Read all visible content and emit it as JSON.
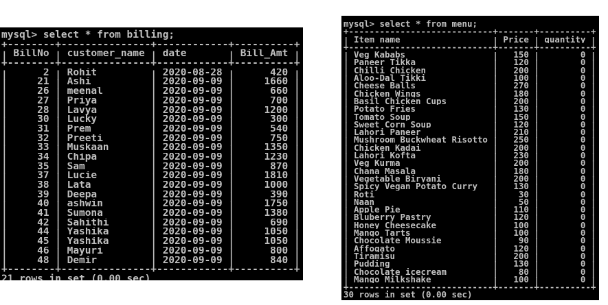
{
  "colors": {
    "page_background": "#ffffff",
    "console_background": "#000000",
    "console_text": "#c0c0c0"
  },
  "billing_console": {
    "prompt": "mysql>",
    "command": "select * from billing;",
    "columns": [
      "BillNo",
      "customer_name",
      "date",
      "Bill_Amt"
    ],
    "rows": [
      [
        2,
        "Rohit",
        "2020-08-28",
        420
      ],
      [
        21,
        "Ashi",
        "2020-09-09",
        1660
      ],
      [
        26,
        "meenal",
        "2020-09-09",
        660
      ],
      [
        27,
        "Priya",
        "2020-09-09",
        700
      ],
      [
        28,
        "Lavya",
        "2020-09-09",
        1200
      ],
      [
        30,
        "Lucky",
        "2020-09-09",
        300
      ],
      [
        31,
        "Prem",
        "2020-09-09",
        540
      ],
      [
        32,
        "Preeti",
        "2020-09-09",
        750
      ],
      [
        33,
        "Muskaan",
        "2020-09-09",
        1350
      ],
      [
        34,
        "Chipa",
        "2020-09-09",
        1230
      ],
      [
        35,
        "Sam",
        "2020-09-09",
        870
      ],
      [
        37,
        "Lucie",
        "2020-09-09",
        1810
      ],
      [
        38,
        "Lata",
        "2020-09-09",
        1000
      ],
      [
        39,
        "Deepa",
        "2020-09-09",
        390
      ],
      [
        40,
        "ashwin",
        "2020-09-09",
        1750
      ],
      [
        41,
        "Sumona",
        "2020-09-09",
        1380
      ],
      [
        42,
        "Sahithi",
        "2020-09-09",
        690
      ],
      [
        44,
        "Yashika",
        "2020-09-09",
        1050
      ],
      [
        45,
        "Yashika",
        "2020-09-09",
        1050
      ],
      [
        46,
        "Mayuri",
        "2020-09-09",
        800
      ],
      [
        48,
        "Demir",
        "2020-09-09",
        840
      ]
    ],
    "summary": "21 rows in set (0.00 sec)"
  },
  "menu_console": {
    "prompt": "mysql>",
    "command": "select * from menu;",
    "columns": [
      "Item_name",
      "Price",
      "quantity"
    ],
    "rows": [
      [
        "Veg Kababs",
        150,
        0
      ],
      [
        "Paneer Tikka",
        120,
        0
      ],
      [
        "Chilli Chicken",
        200,
        0
      ],
      [
        "Aloo-Dal Tikki",
        100,
        0
      ],
      [
        "Cheese Balls",
        270,
        0
      ],
      [
        "Chicken Wings",
        180,
        0
      ],
      [
        "Basil Chicken Cups",
        200,
        0
      ],
      [
        "Potato Fries",
        130,
        0
      ],
      [
        "Tomato Soup",
        150,
        0
      ],
      [
        "Sweet Corn Soup",
        120,
        0
      ],
      [
        "Lahori Paneer",
        210,
        0
      ],
      [
        "Mushroom Buckwheat Risotto",
        250,
        0
      ],
      [
        "Chicken Kadai",
        200,
        0
      ],
      [
        "Lahori Kofta",
        230,
        0
      ],
      [
        "Veg Kurma",
        200,
        0
      ],
      [
        "Chana Masala",
        180,
        0
      ],
      [
        "Vegetable Biryani",
        200,
        0
      ],
      [
        "Spicy Vegan Potato Curry",
        130,
        0
      ],
      [
        "Roti",
        30,
        0
      ],
      [
        "Naan",
        50,
        0
      ],
      [
        "Apple Pie",
        110,
        0
      ],
      [
        "Bluberry Pastry",
        120,
        0
      ],
      [
        "Honey Cheesecake",
        100,
        0
      ],
      [
        "Mango Tarts",
        100,
        0
      ],
      [
        "Chocolate Moussie",
        90,
        0
      ],
      [
        "Affogato",
        120,
        0
      ],
      [
        "Tiramisu",
        200,
        0
      ],
      [
        "Pudding",
        130,
        0
      ],
      [
        "Chocolate icecream",
        80,
        0
      ],
      [
        "Mango Milkshake",
        100,
        0
      ]
    ],
    "summary": "30 rows in set (0.00 sec)"
  }
}
